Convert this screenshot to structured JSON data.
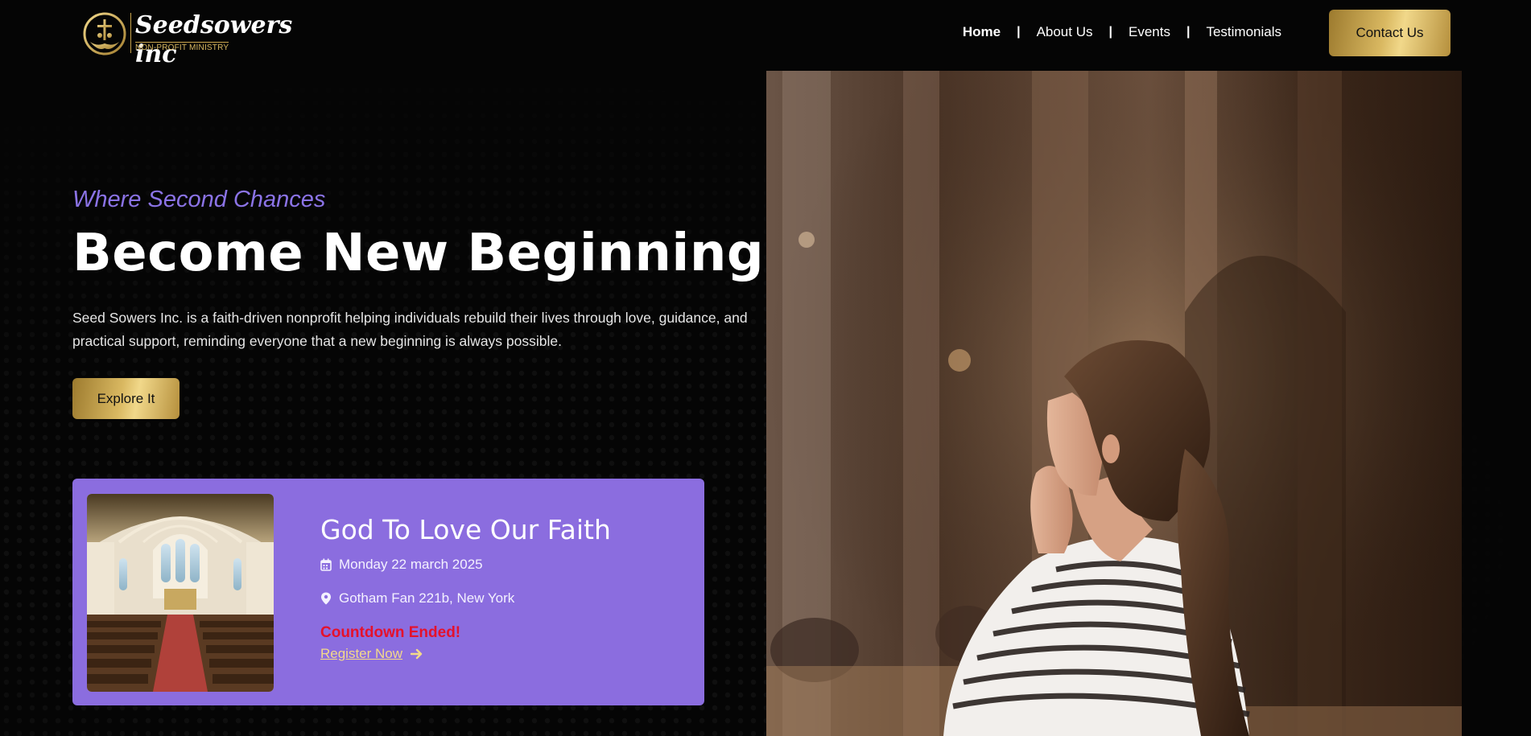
{
  "brand": {
    "name": "Seedsowers inc",
    "subtitle": "NON-PROFIT MINISTRY"
  },
  "nav": {
    "items": [
      {
        "label": "Home",
        "active": true
      },
      {
        "label": "About Us",
        "active": false
      },
      {
        "label": "Events",
        "active": false
      },
      {
        "label": "Testimonials",
        "active": false
      }
    ],
    "separator": "|",
    "contact_label": "Contact Us"
  },
  "hero": {
    "tagline": "Where Second Chances",
    "headline": "Become New Beginnings",
    "description": "Seed Sowers Inc. is a faith-driven nonprofit helping individuals rebuild their lives through love, guidance, and practical support, reminding everyone that a new beginning is always possible.",
    "cta_label": "Explore It"
  },
  "event": {
    "title": "God To Love Our Faith",
    "date": "Monday 22 march 2025",
    "location": "Gotham Fan 221b, New York",
    "countdown_status": "Countdown Ended!",
    "register_label": "Register Now"
  },
  "colors": {
    "background": "#050505",
    "accent_purple": "#8b6ddf",
    "tagline_purple": "#8b73e6",
    "gold": "#d9b861",
    "countdown_red": "#e5112b"
  },
  "icons": {
    "calendar": "calendar-icon",
    "location": "map-pin-icon",
    "arrow": "arrow-right-icon"
  }
}
